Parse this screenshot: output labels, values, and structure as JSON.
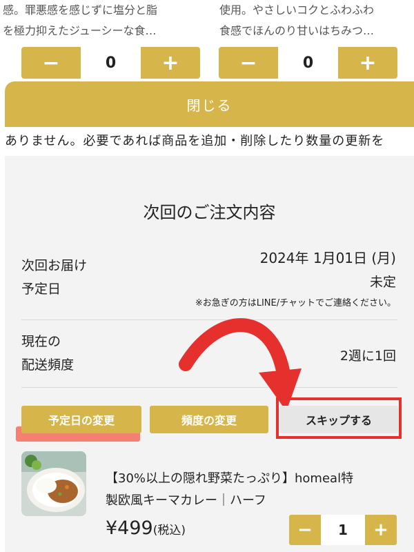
{
  "products_top": [
    {
      "desc_line1": "感。罪悪感を感じずに塩分と脂",
      "desc_line2": "を極力抑えたジューシーな食…",
      "minus": "−",
      "qty": "0",
      "plus": "+"
    },
    {
      "desc_line1": "使用。やさしいコクとふわふわ",
      "desc_line2": "食感でほんのり甘いはちみつ…",
      "minus": "−",
      "qty": "0",
      "plus": "+"
    }
  ],
  "modal": {
    "close_label": "閉じる",
    "notice_text": "ありません。必要であれば商品を追加・削除したり数量の更新を"
  },
  "order": {
    "title": "次回のご注文内容",
    "delivery_label_line1": "次回お届け",
    "delivery_label_line2": "予定日",
    "delivery_date": "2024年 1月01日 (月)",
    "delivery_status": "未定",
    "contact_note": "※お急ぎの方はLINE/チャットでご連絡ください。",
    "frequency_label_line1": "現在の",
    "frequency_label_line2": "配送頻度",
    "frequency_value": "2週に1回"
  },
  "actions": {
    "change_date": "予定日の変更",
    "change_frequency": "頻度の変更",
    "skip": "スキップする"
  },
  "item": {
    "name_line1": "【30%以上の隠れ野菜たっぷり】homeal特",
    "name_line2": "製欧風キーマカレー｜ハーフ",
    "price": "¥499",
    "tax_note": "(税込)",
    "minus": "−",
    "qty": "1",
    "plus": "+"
  },
  "colors": {
    "accent": "#d6b54a",
    "highlight_red": "#e5302e",
    "marker": "#f46b5a"
  }
}
